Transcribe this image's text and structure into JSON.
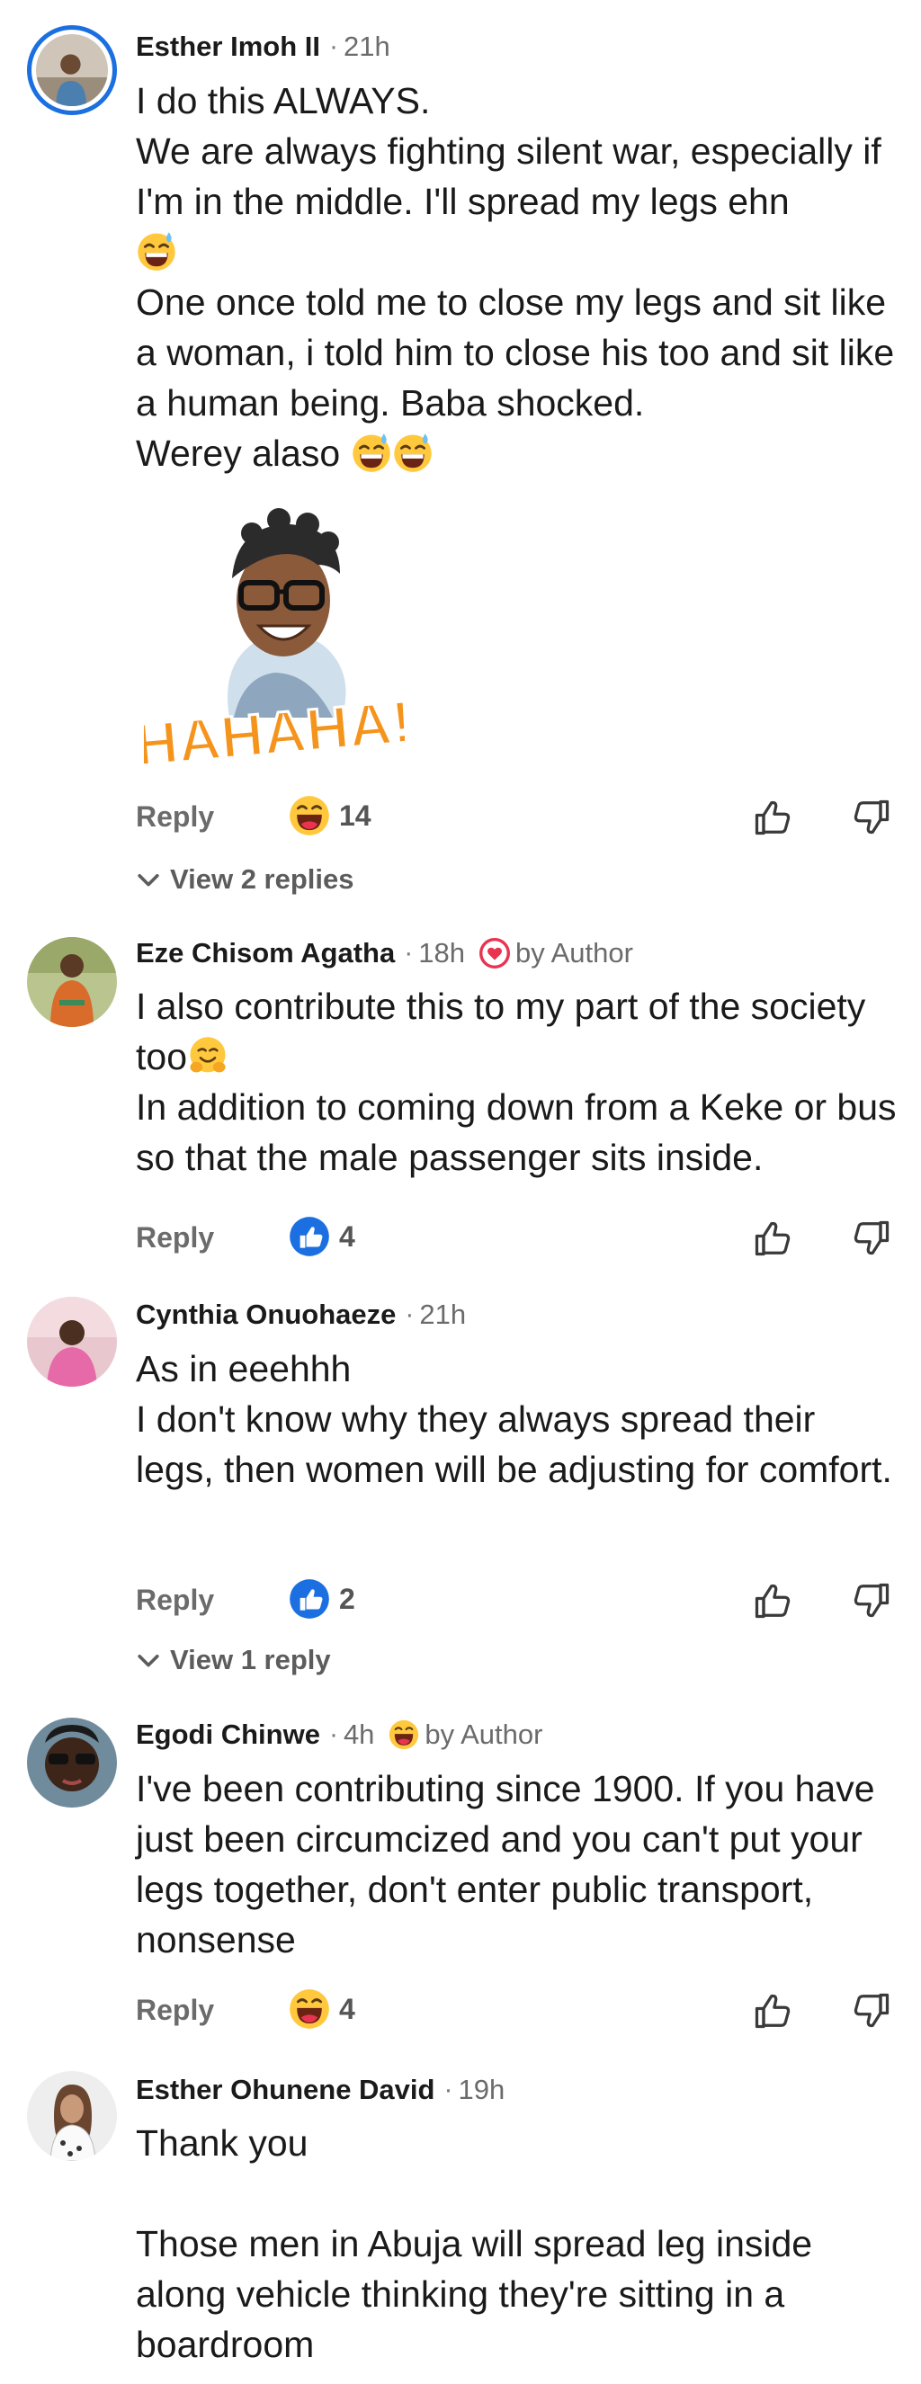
{
  "comments": [
    {
      "name": "Esther Imoh II",
      "time": "21h",
      "lines": [
        "I do this ALWAYS.",
        "We are always fighting silent war, especially if I'm in the middle. I'll spread my legs ehn",
        "One once told me to close my legs and sit like a woman, i told him to close his too and sit like a human being. Baba shocked.",
        "Werey alaso"
      ],
      "sticker_text": "HAHAHA!",
      "reply_label": "Reply",
      "reaction_count": "14",
      "view_replies": "View 2 replies"
    },
    {
      "name": "Eze Chisom Agatha",
      "time": "18h",
      "badge": "by Author",
      "lines": [
        "I also contribute this to my part of the society too",
        "In addition to coming down from a Keke or bus so that the male passenger sits inside."
      ],
      "reply_label": "Reply",
      "reaction_count": "4"
    },
    {
      "name": "Cynthia Onuohaeze",
      "time": "21h",
      "lines": [
        "As in eeehhh",
        "I don't know why they always spread their legs, then women will be adjusting for comfort."
      ],
      "reply_label": "Reply",
      "reaction_count": "2",
      "view_replies": "View 1 reply"
    },
    {
      "name": "Egodi Chinwe",
      "time": "4h",
      "badge": "by Author",
      "lines": [
        "I've been contributing since 1900. If you have just been circumcized and you can't put your legs together, don't enter public transport, nonsense"
      ],
      "reply_label": "Reply",
      "reaction_count": "4"
    },
    {
      "name": "Esther Ohunene David",
      "time": "19h",
      "lines": [
        "Thank you",
        "Those men in Abuja will spread leg inside along vehicle thinking they're sitting in a boardroom"
      ]
    }
  ],
  "sep": "·",
  "colors": {
    "accent_blue": "#1b6fe0",
    "author_red": "#e8344f",
    "sticker_orange": "#f5941d",
    "text": "#1a1a1a",
    "muted": "#6b6b6b"
  },
  "icons": {
    "reaction_haha": "haha-emoji-icon",
    "reaction_like": "like-circle-icon",
    "thumbs_up": "thumbs-up-icon",
    "thumbs_down": "thumbs-down-icon",
    "chevron": "chevron-down-icon"
  }
}
